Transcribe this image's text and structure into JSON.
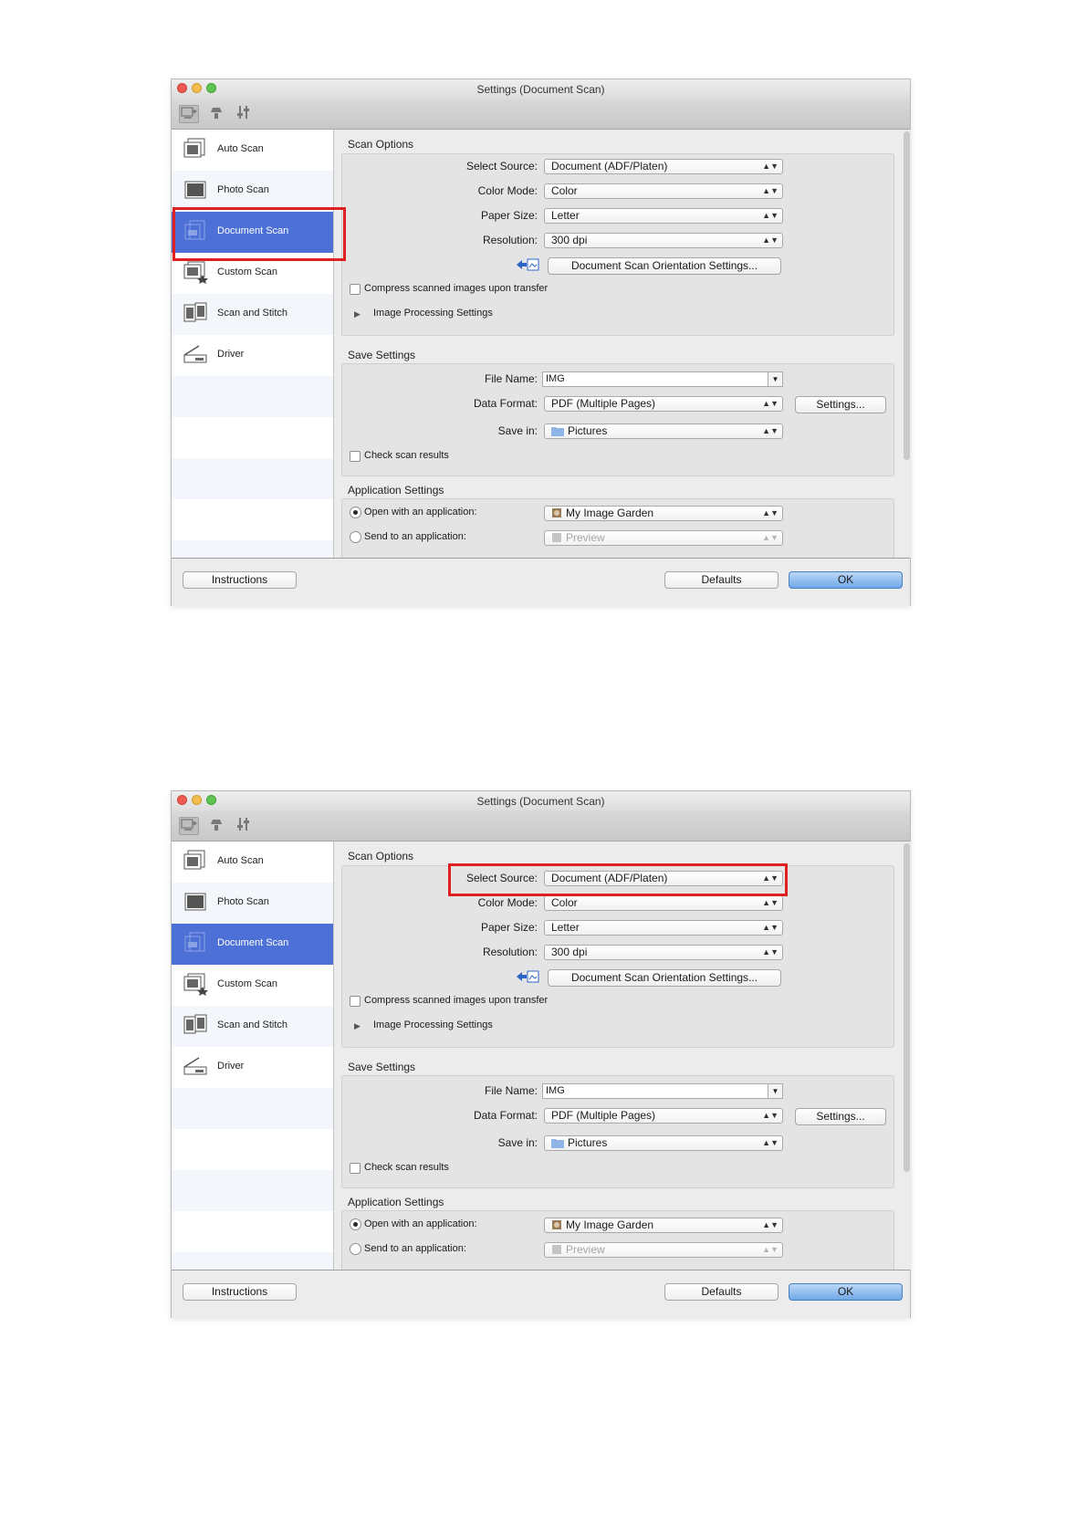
{
  "panels": [
    {
      "window_title": "Settings (Document Scan)",
      "highlight": "document-scan-sidebar"
    },
    {
      "window_title": "Settings (Document Scan)",
      "highlight": "select-source-row"
    }
  ],
  "toolbar": {
    "icons": [
      "scan-from-computer-icon",
      "scan-from-operation-panel-icon",
      "general-settings-icon"
    ]
  },
  "sidebar": {
    "items": [
      {
        "label": "Auto Scan",
        "icon": "auto-scan-icon"
      },
      {
        "label": "Photo Scan",
        "icon": "photo-scan-icon"
      },
      {
        "label": "Document Scan",
        "icon": "document-scan-icon",
        "selected": true
      },
      {
        "label": "Custom Scan",
        "icon": "custom-scan-icon"
      },
      {
        "label": "Scan and Stitch",
        "icon": "scan-and-stitch-icon"
      },
      {
        "label": "Driver",
        "icon": "driver-icon"
      }
    ]
  },
  "scan_options": {
    "title": "Scan Options",
    "select_source_label": "Select Source:",
    "select_source_value": "Document (ADF/Platen)",
    "color_mode_label": "Color Mode:",
    "color_mode_value": "Color",
    "paper_size_label": "Paper Size:",
    "paper_size_value": "Letter",
    "resolution_label": "Resolution:",
    "resolution_value": "300 dpi",
    "orientation_button": "Document Scan Orientation Settings...",
    "compress_label": "Compress scanned images upon transfer",
    "compress_checked": false,
    "image_processing_label": "Image Processing Settings"
  },
  "save_settings": {
    "title": "Save Settings",
    "file_name_label": "File Name:",
    "file_name_value": "IMG",
    "data_format_label": "Data Format:",
    "data_format_value": "PDF (Multiple Pages)",
    "settings_button": "Settings...",
    "save_in_label": "Save in:",
    "save_in_value": "Pictures",
    "check_results_label": "Check scan results",
    "check_results_checked": false
  },
  "application_settings": {
    "title": "Application Settings",
    "open_with_label": "Open with an application:",
    "open_with_value": "My Image Garden",
    "open_with_selected": true,
    "send_to_label": "Send to an application:",
    "send_to_value": "Preview"
  },
  "footer": {
    "instructions_button": "Instructions",
    "defaults_button": "Defaults",
    "ok_button": "OK"
  },
  "colors": {
    "selection": "#4d70d6",
    "highlight_box": "#e02020",
    "ok_button": "#6fa8e8"
  }
}
